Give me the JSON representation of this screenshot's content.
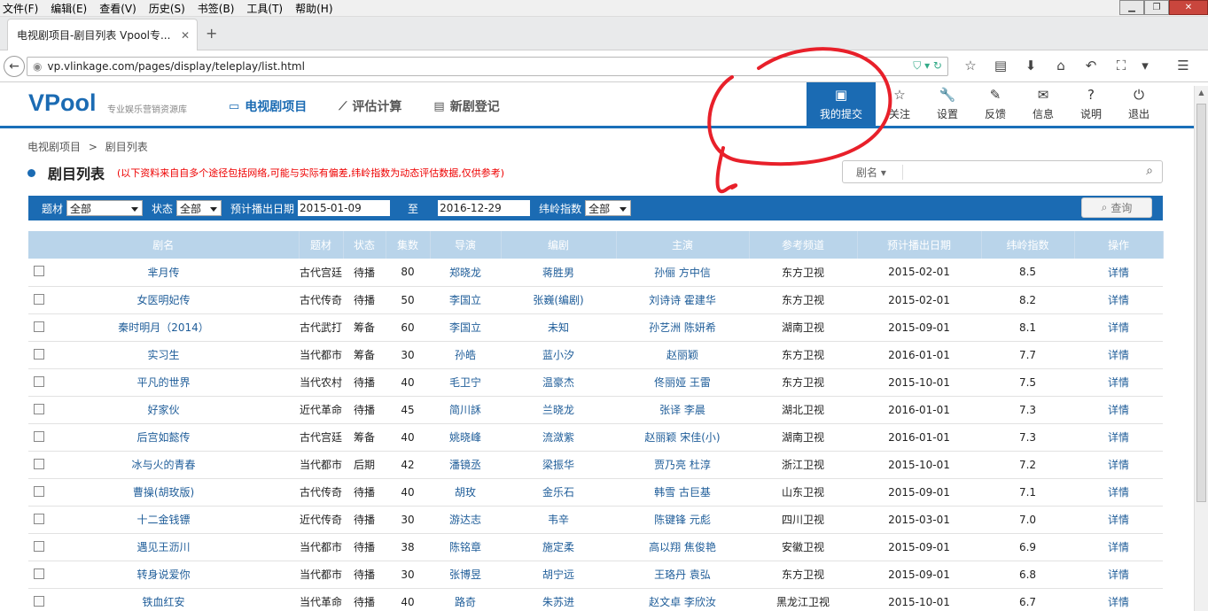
{
  "browser": {
    "menu": [
      "文件(F)",
      "编辑(E)",
      "查看(V)",
      "历史(S)",
      "书签(B)",
      "工具(T)",
      "帮助(H)"
    ],
    "tab_title": "电视剧项目-剧目列表 Vpool专...",
    "url": "vp.vlinkage.com/pages/display/teleplay/list.html"
  },
  "header": {
    "logo": "VPool",
    "slogan": "专业娱乐营销资源库",
    "nav": [
      {
        "label": "电视剧项目",
        "icon": "monitor-icon"
      },
      {
        "label": "评估计算",
        "icon": "chart-icon"
      },
      {
        "label": "新剧登记",
        "icon": "register-icon"
      }
    ],
    "tools": [
      {
        "label": "我的提交",
        "icon": "submit-icon"
      },
      {
        "label": "关注",
        "icon": "star-icon"
      },
      {
        "label": "设置",
        "icon": "wrench-icon"
      },
      {
        "label": "反馈",
        "icon": "pencil-icon"
      },
      {
        "label": "信息",
        "icon": "mail-icon"
      },
      {
        "label": "说明",
        "icon": "help-icon"
      },
      {
        "label": "退出",
        "icon": "power-icon"
      }
    ]
  },
  "breadcrumb": {
    "root": "电视剧项目",
    "sep": ">",
    "current": "剧目列表"
  },
  "page": {
    "title": "剧目列表",
    "note": "(以下资料来自自多个途径包括网络,可能与实际有偏差,纬岭指数为动态评估数据,仅供参考)"
  },
  "search": {
    "field": "剧名"
  },
  "filter": {
    "genre_label": "题材",
    "genre_value": "全部",
    "status_label": "状态",
    "status_value": "全部",
    "date_label": "预计播出日期",
    "date_from": "2015-01-09",
    "to_label": "至",
    "date_to": "2016-12-29",
    "index_label": "纬岭指数",
    "index_value": "全部",
    "query_label": "查询"
  },
  "table": {
    "headers": [
      "剧名",
      "题材",
      "状态",
      "集数",
      "导演",
      "编剧",
      "主演",
      "参考频道",
      "预计播出日期",
      "纬岭指数",
      "操作"
    ],
    "rows": [
      [
        "芈月传",
        "古代宫廷",
        "待播",
        "80",
        "郑晓龙",
        "蒋胜男",
        "孙俪  方中信",
        "东方卫视",
        "2015-02-01",
        "8.5",
        "详情"
      ],
      [
        "女医明妃传",
        "古代传奇",
        "待播",
        "50",
        "李国立",
        "张巍(编剧)",
        "刘诗诗  霍建华",
        "东方卫视",
        "2015-02-01",
        "8.2",
        "详情"
      ],
      [
        "秦时明月（2014）",
        "古代武打",
        "筹备",
        "60",
        "李国立",
        "未知",
        "孙艺洲  陈妍希",
        "湖南卫视",
        "2015-09-01",
        "8.1",
        "详情"
      ],
      [
        "实习生",
        "当代都市",
        "筹备",
        "30",
        "孙皓",
        "蓝小汐",
        "赵丽颖",
        "东方卫视",
        "2016-01-01",
        "7.7",
        "详情"
      ],
      [
        "平凡的世界",
        "当代农村",
        "待播",
        "40",
        "毛卫宁",
        "温豪杰",
        "佟丽娅  王雷",
        "东方卫视",
        "2015-10-01",
        "7.5",
        "详情"
      ],
      [
        "好家伙",
        "近代革命",
        "待播",
        "45",
        "简川訸",
        "兰晓龙",
        "张译  李晨",
        "湖北卫视",
        "2016-01-01",
        "7.3",
        "详情"
      ],
      [
        "后宫如懿传",
        "古代宫廷",
        "筹备",
        "40",
        "姚晓峰",
        "流潋紫",
        "赵丽颖  宋佳(小)",
        "湖南卫视",
        "2016-01-01",
        "7.3",
        "详情"
      ],
      [
        "冰与火的青春",
        "当代都市",
        "后期",
        "42",
        "潘镜丞",
        "梁振华",
        "贾乃亮  杜淳",
        "浙江卫视",
        "2015-10-01",
        "7.2",
        "详情"
      ],
      [
        "曹操(胡玫版)",
        "古代传奇",
        "待播",
        "40",
        "胡玫",
        "金乐石",
        "韩雪  古巨基",
        "山东卫视",
        "2015-09-01",
        "7.1",
        "详情"
      ],
      [
        "十二金钱镖",
        "近代传奇",
        "待播",
        "30",
        "游达志",
        "韦辛",
        "陈键锋  元彪",
        "四川卫视",
        "2015-03-01",
        "7.0",
        "详情"
      ],
      [
        "遇见王沥川",
        "当代都市",
        "待播",
        "38",
        "陈铭章",
        "施定柔",
        "高以翔  焦俊艳",
        "安徽卫视",
        "2015-09-01",
        "6.9",
        "详情"
      ],
      [
        "转身说爱你",
        "当代都市",
        "待播",
        "30",
        "张博昱",
        "胡宁远",
        "王珞丹  袁弘",
        "东方卫视",
        "2015-09-01",
        "6.8",
        "详情"
      ],
      [
        "铁血红安",
        "当代革命",
        "待播",
        "40",
        "路奇",
        "朱苏进",
        "赵文卓  李欣汝",
        "黑龙江卫视",
        "2015-10-01",
        "6.7",
        "详情"
      ]
    ]
  },
  "colors": {
    "brand": "#1b6bb3",
    "header_row": "#b9d4ea",
    "note": "#e00000",
    "annotation": "#e8202a"
  }
}
